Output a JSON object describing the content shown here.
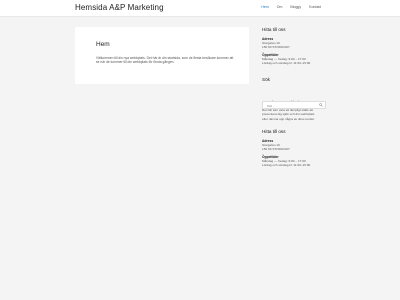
{
  "site": {
    "title": "Hemsida A&P Marketing"
  },
  "nav": {
    "items": [
      {
        "label": "Hem",
        "active": true
      },
      {
        "label": "Om"
      },
      {
        "label": "Bloggy"
      },
      {
        "label": "Kontakt"
      }
    ]
  },
  "main": {
    "title": "Hem",
    "text": "Välkommen till din nya webbplats. Det här är din startsida, som de flesta besökare kommer att se när de kommer till din webbplats för första gången."
  },
  "sidebar": {
    "find_us": {
      "title": "Hitta till oss",
      "address_label": "Adress",
      "address_lines": [
        "Storgatan 10",
        "150 00 STOROGRY"
      ],
      "hours_label": "Öppettider",
      "hours_lines": [
        "Måndag — fredag: 9:00 – 17:00",
        "Lördag och söndag kl: 11:00–15:00"
      ]
    },
    "search": {
      "title": "Sök",
      "placeholder": "Sök …"
    },
    "about": {
      "title": "Om denna webbplats",
      "lines": [
        "Det här kan vara ett lämpligt ställe att",
        "presentera dig själv och din webbplats",
        "eller nämna upp några av dina meriter."
      ]
    },
    "find_us_2": {
      "title": "Hitta till oss",
      "address_label": "Adress",
      "address_lines": [
        "Storgatan 10",
        "150 00 STOROGRY"
      ],
      "hours_label": "Öppettider",
      "hours_lines": [
        "Måndag — fredag: 9:00 – 17:00",
        "Lördag och söndag kl: 11:00–15:00"
      ]
    }
  }
}
